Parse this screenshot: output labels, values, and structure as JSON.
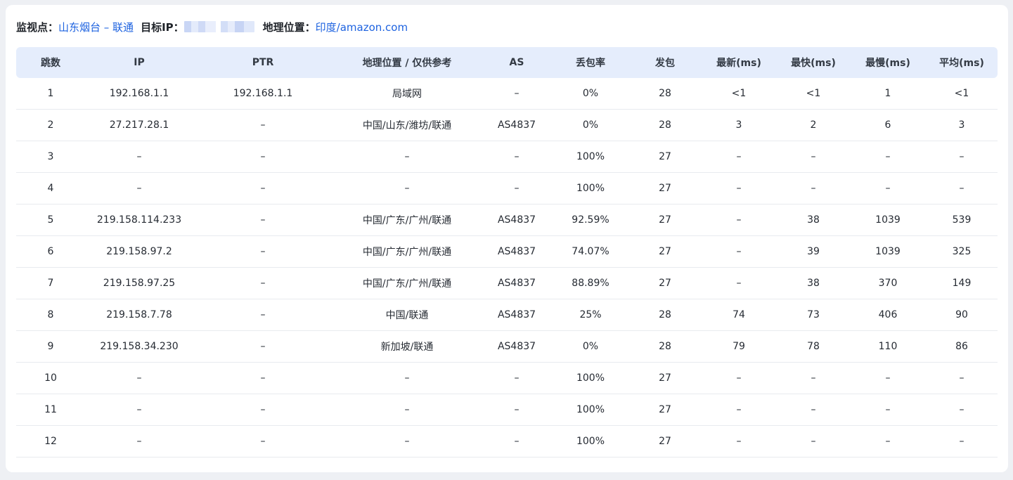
{
  "header": {
    "monitor_label": "监视点：",
    "monitor_value": "山东烟台 – 联通",
    "target_ip_label": "目标IP：",
    "location_label": "地理位置：",
    "location_value": "印度/amazon.com"
  },
  "table": {
    "columns": [
      "跳数",
      "IP",
      "PTR",
      "地理位置 / 仅供参考",
      "AS",
      "丢包率",
      "发包",
      "最新(ms)",
      "最快(ms)",
      "最慢(ms)",
      "平均(ms)"
    ],
    "rows": [
      [
        "1",
        "192.168.1.1",
        "192.168.1.1",
        "局域网",
        "–",
        "0%",
        "28",
        "<1",
        "<1",
        "1",
        "<1"
      ],
      [
        "2",
        "27.217.28.1",
        "–",
        "中国/山东/潍坊/联通",
        "AS4837",
        "0%",
        "28",
        "3",
        "2",
        "6",
        "3"
      ],
      [
        "3",
        "–",
        "–",
        "–",
        "–",
        "100%",
        "27",
        "–",
        "–",
        "–",
        "–"
      ],
      [
        "4",
        "–",
        "–",
        "–",
        "–",
        "100%",
        "27",
        "–",
        "–",
        "–",
        "–"
      ],
      [
        "5",
        "219.158.114.233",
        "–",
        "中国/广东/广州/联通",
        "AS4837",
        "92.59%",
        "27",
        "–",
        "38",
        "1039",
        "539"
      ],
      [
        "6",
        "219.158.97.2",
        "–",
        "中国/广东/广州/联通",
        "AS4837",
        "74.07%",
        "27",
        "–",
        "39",
        "1039",
        "325"
      ],
      [
        "7",
        "219.158.97.25",
        "–",
        "中国/广东/广州/联通",
        "AS4837",
        "88.89%",
        "27",
        "–",
        "38",
        "370",
        "149"
      ],
      [
        "8",
        "219.158.7.78",
        "–",
        "中国/联通",
        "AS4837",
        "25%",
        "28",
        "74",
        "73",
        "406",
        "90"
      ],
      [
        "9",
        "219.158.34.230",
        "–",
        "新加坡/联通",
        "AS4837",
        "0%",
        "28",
        "79",
        "78",
        "110",
        "86"
      ],
      [
        "10",
        "–",
        "–",
        "–",
        "–",
        "100%",
        "27",
        "–",
        "–",
        "–",
        "–"
      ],
      [
        "11",
        "–",
        "–",
        "–",
        "–",
        "100%",
        "27",
        "–",
        "–",
        "–",
        "–"
      ],
      [
        "12",
        "–",
        "–",
        "–",
        "–",
        "100%",
        "27",
        "–",
        "–",
        "–",
        "–"
      ]
    ]
  },
  "colors": {
    "link": "#1e63e0",
    "header_bg": "#e5edfc",
    "page_bg": "#eef0f4"
  }
}
